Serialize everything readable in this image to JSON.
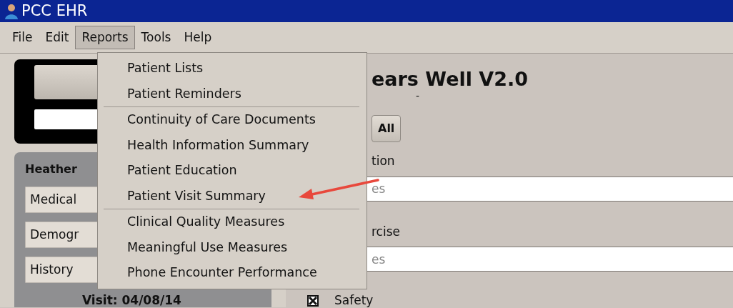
{
  "window": {
    "title": "PCC EHR"
  },
  "menu_bar": [
    {
      "label": "File",
      "selected": false
    },
    {
      "label": "Edit",
      "selected": false
    },
    {
      "label": "Reports",
      "selected": true
    },
    {
      "label": "Tools",
      "selected": false
    },
    {
      "label": "Help",
      "selected": false
    }
  ],
  "dropdown": {
    "items": [
      {
        "kind": "item",
        "label": "Patient Lists"
      },
      {
        "kind": "item",
        "label": "Patient Reminders"
      },
      {
        "kind": "separator"
      },
      {
        "kind": "item",
        "label": "Continuity of Care Documents"
      },
      {
        "kind": "item",
        "label": "Health Information Summary"
      },
      {
        "kind": "item",
        "label": "Patient Education"
      },
      {
        "kind": "item",
        "label": "Patient Visit Summary"
      },
      {
        "kind": "separator"
      },
      {
        "kind": "item",
        "label": "Clinical Quality Measures"
      },
      {
        "kind": "item",
        "label": "Meaningful Use Measures"
      },
      {
        "kind": "item",
        "label": "Phone Encounter Performance"
      }
    ]
  },
  "sidebar": {
    "patient_name": "Heather",
    "buttons": [
      "Medical",
      "Demogr",
      "History"
    ],
    "visit": "Visit: 04/08/14"
  },
  "form": {
    "title": "ears Well V2.0",
    "subtitle": "-",
    "all_button": "All",
    "sections": [
      {
        "label": "tion",
        "placeholder": "es"
      },
      {
        "label": "rcise",
        "placeholder": "es"
      }
    ],
    "checkboxes": [
      {
        "label": "Safety",
        "checked": true
      }
    ]
  }
}
